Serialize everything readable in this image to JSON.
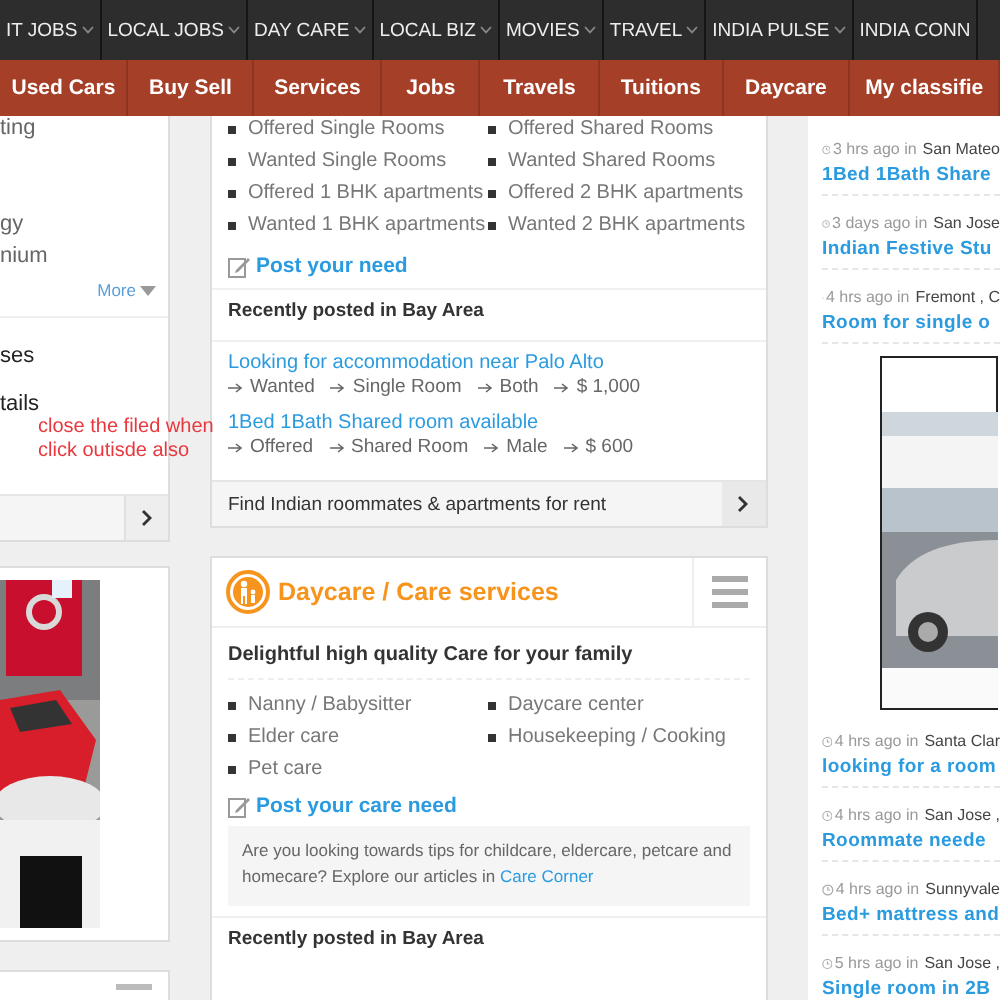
{
  "top_nav": [
    {
      "label": "IT JOBS",
      "caret": true
    },
    {
      "label": "LOCAL JOBS",
      "caret": true
    },
    {
      "label": "DAY CARE",
      "caret": true
    },
    {
      "label": "LOCAL BIZ",
      "caret": true
    },
    {
      "label": "MOVIES",
      "caret": true
    },
    {
      "label": "TRAVEL",
      "caret": true
    },
    {
      "label": "INDIA PULSE",
      "caret": true
    },
    {
      "label": "INDIA CONN",
      "caret": false
    }
  ],
  "category_bar": [
    "Used Cars",
    "Buy Sell",
    "Services",
    "Jobs",
    "Travels",
    "Tuitions",
    "Daycare",
    "My classifie"
  ],
  "left_panel": {
    "items": [
      "ting",
      "gy",
      "nium"
    ],
    "more": "More",
    "sections": [
      "ses",
      "tails"
    ],
    "note": "close the filed when click outisde also"
  },
  "rooms_card": {
    "items": [
      "Offered Single Rooms",
      "Offered Shared Rooms",
      "Wanted Single Rooms",
      "Wanted Shared Rooms",
      "Offered 1 BHK apartments",
      "Offered 2 BHK apartments",
      "Wanted 1 BHK apartments",
      "Wanted 2 BHK apartments"
    ],
    "post_link": "Post your need",
    "recent_heading": "Recently posted in Bay Area",
    "posts": [
      {
        "title": "Looking for accommodation near Palo Alto",
        "tags": [
          "Wanted",
          "Single Room",
          "Both",
          "$ 1,000"
        ]
      },
      {
        "title": "1Bed 1Bath Shared room available",
        "tags": [
          "Offered",
          "Shared Room",
          "Male",
          "$ 600"
        ]
      }
    ],
    "footer": "Find Indian roommates & apartments for rent"
  },
  "daycare_card": {
    "title": "Daycare / Care services",
    "subtitle": "Delightful high quality Care for your family",
    "items": [
      "Nanny / Babysitter",
      "Daycare center",
      "Elder care",
      "Housekeeping / Cooking",
      "Pet care"
    ],
    "post_link": "Post your care need",
    "tip": {
      "text": "Are you looking towards tips for childcare, eldercare, petcare and homecare? Explore our articles in ",
      "link": "Care Corner"
    },
    "recent_heading": "Recently posted in Bay Area"
  },
  "recent_feed": [
    {
      "kind": "post",
      "time": "3 hrs ago in",
      "place": "San Mateo",
      "title": "1Bed 1Bath Share"
    },
    {
      "kind": "post",
      "time": "3 days ago in",
      "place": "San Jose",
      "title": "Indian Festive Stu"
    },
    {
      "kind": "post",
      "time": "4 hrs ago in",
      "place": "Fremont , C",
      "title": "Room for single o"
    },
    {
      "kind": "ad"
    },
    {
      "kind": "post",
      "time": "4 hrs ago in",
      "place": "Santa Clar",
      "title": "looking for a room"
    },
    {
      "kind": "post",
      "time": "4 hrs ago in",
      "place": "San Jose ,",
      "title": "Roommate neede"
    },
    {
      "kind": "post",
      "time": "4 hrs ago in",
      "place": "Sunnyvale",
      "title": "Bed+ mattress and"
    },
    {
      "kind": "post",
      "time": "5 hrs ago in",
      "place": "San Jose ,",
      "title": "Single room in 2B"
    }
  ]
}
